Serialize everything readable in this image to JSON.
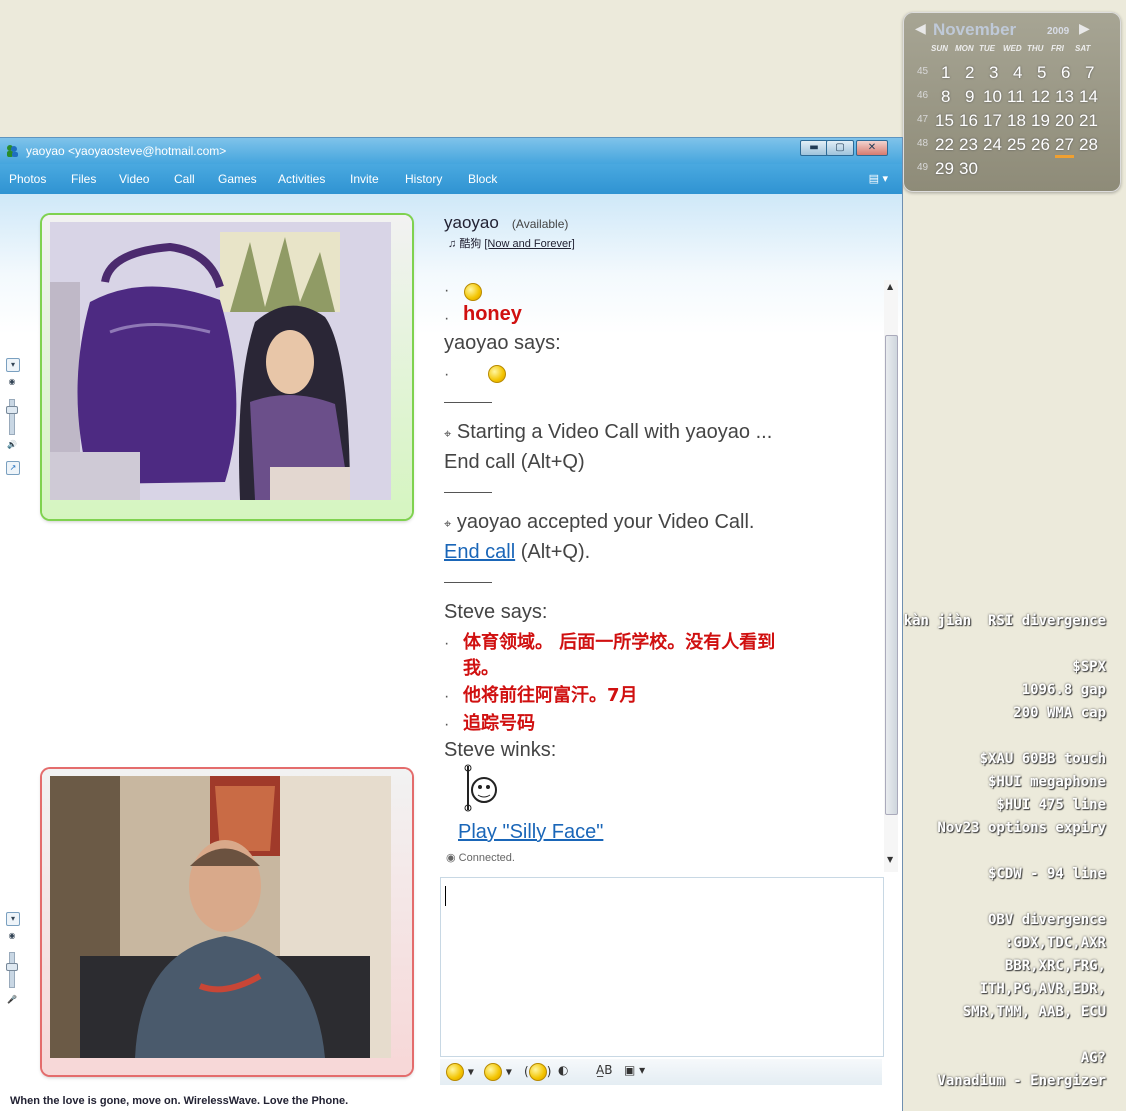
{
  "calendar": {
    "month": "November",
    "year": "2009",
    "days_of_week": [
      "SUN",
      "MON",
      "TUE",
      "WED",
      "THU",
      "FRI",
      "SAT"
    ],
    "weeks": [
      {
        "num": "45",
        "days": [
          "1",
          "2",
          "3",
          "4",
          "5",
          "6",
          "7"
        ]
      },
      {
        "num": "46",
        "days": [
          "8",
          "9",
          "10",
          "11",
          "12",
          "13",
          "14"
        ]
      },
      {
        "num": "47",
        "days": [
          "15",
          "16",
          "17",
          "18",
          "19",
          "20",
          "21"
        ]
      },
      {
        "num": "48",
        "days": [
          "22",
          "23",
          "24",
          "25",
          "26",
          "27",
          "28"
        ]
      },
      {
        "num": "49",
        "days": [
          "29",
          "30"
        ]
      }
    ],
    "today": "27"
  },
  "desktop_notes": [
    "kàn jiàn  RSI divergence",
    "",
    "$SPX",
    "1096.8 gap",
    "200 WMA cap",
    "",
    "$XAU 60BB touch",
    "$HUI megaphone",
    "$HUI 475 line",
    "Nov23 options expiry",
    "",
    "$CDW - 94 line",
    "",
    "OBV divergence",
    ":GDX,TDC,AXR",
    "BBR,XRC,FRG,",
    "ITH,PG,AVR,EDR,",
    "SMR,TMM, AAB, ECU",
    "",
    "AG?",
    "Vanadium - Energizer"
  ],
  "window": {
    "title": "yaoyao <yaoyaosteve@hotmail.com>",
    "min": "▬",
    "max": "▢",
    "close": "✕",
    "menu": [
      "Photos",
      "Files",
      "Video",
      "Call",
      "Games",
      "Activities",
      "Invite",
      "History",
      "Block"
    ],
    "menu_ctl": "▾"
  },
  "contact": {
    "name": "yaoyao",
    "status": "(Available)",
    "music_prefix": "酷狗",
    "music_link": "[Now and Forever]"
  },
  "chat": {
    "honey": "honey",
    "yaoyao_says": "yaoyao says:",
    "start_call": "Starting a Video Call with yaoyao ...",
    "end_call_1": "End call (Alt+Q)",
    "accepted": "yaoyao accepted your Video Call.",
    "end_call_link": "End call",
    "end_call_suffix": "(Alt+Q).",
    "steve_says": "Steve says:",
    "msg1a": "体育领域。 后面一所学校。没有人看到",
    "msg1b": "我。",
    "msg2": "他将前往阿富汗。7月",
    "msg3": "追踪号码",
    "steve_winks": "Steve winks:",
    "play_link": "Play \"Silly Face\"",
    "connected": "Connected."
  },
  "statusbar": "When the love is gone, move on. WirelessWave. Love the Phone."
}
